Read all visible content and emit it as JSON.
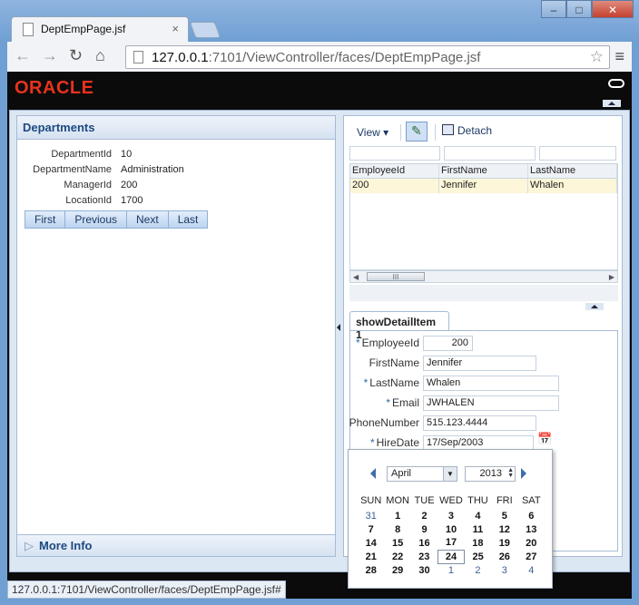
{
  "browser": {
    "tab_title": "DeptEmpPage.jsf",
    "url_host": "127.0.0.1",
    "url_rest": ":7101/ViewController/faces/DeptEmpPage.jsf",
    "status_url": "127.0.0.1:7101/ViewController/faces/DeptEmpPage.jsf#"
  },
  "header": {
    "logo_text": "ORACLE"
  },
  "departments": {
    "title": "Departments",
    "fields": [
      {
        "label": "DepartmentId",
        "value": "10"
      },
      {
        "label": "DepartmentName",
        "value": "Administration"
      },
      {
        "label": "ManagerId",
        "value": "200"
      },
      {
        "label": "LocationId",
        "value": "1700"
      }
    ],
    "nav": [
      "First",
      "Previous",
      "Next",
      "Last"
    ],
    "more_info": "More Info"
  },
  "employees_table": {
    "toolbar": {
      "view_label": "View",
      "detach_label": "Detach"
    },
    "columns": [
      "EmployeeId",
      "FirstName",
      "LastName"
    ],
    "rows": [
      [
        "200",
        "Jennifer",
        "Whalen"
      ]
    ]
  },
  "detail": {
    "tab_label": "showDetailItem 1",
    "fields": [
      {
        "label": "EmployeeId",
        "value": "200",
        "required": true
      },
      {
        "label": "FirstName",
        "value": "Jennifer",
        "required": false
      },
      {
        "label": "LastName",
        "value": "Whalen",
        "required": true
      },
      {
        "label": "Email",
        "value": "JWHALEN",
        "required": true
      },
      {
        "label": "PhoneNumber",
        "value": "515.123.4444",
        "required": false
      },
      {
        "label": "HireDate",
        "value": "17/Sep/2003",
        "required": true
      }
    ],
    "required_marker": "*"
  },
  "calendar": {
    "month": "April",
    "year": "2013",
    "weekdays": [
      "SUN",
      "MON",
      "TUE",
      "WED",
      "THU",
      "FRI",
      "SAT"
    ],
    "weeks": [
      [
        "31",
        "1",
        "2",
        "3",
        "4",
        "5",
        "6"
      ],
      [
        "7",
        "8",
        "9",
        "10",
        "11",
        "12",
        "13"
      ],
      [
        "14",
        "15",
        "16",
        "17",
        "18",
        "19",
        "20"
      ],
      [
        "21",
        "22",
        "23",
        "24",
        "25",
        "26",
        "27"
      ],
      [
        "28",
        "29",
        "30",
        "1",
        "2",
        "3",
        "4"
      ]
    ],
    "selected_day": "24"
  }
}
